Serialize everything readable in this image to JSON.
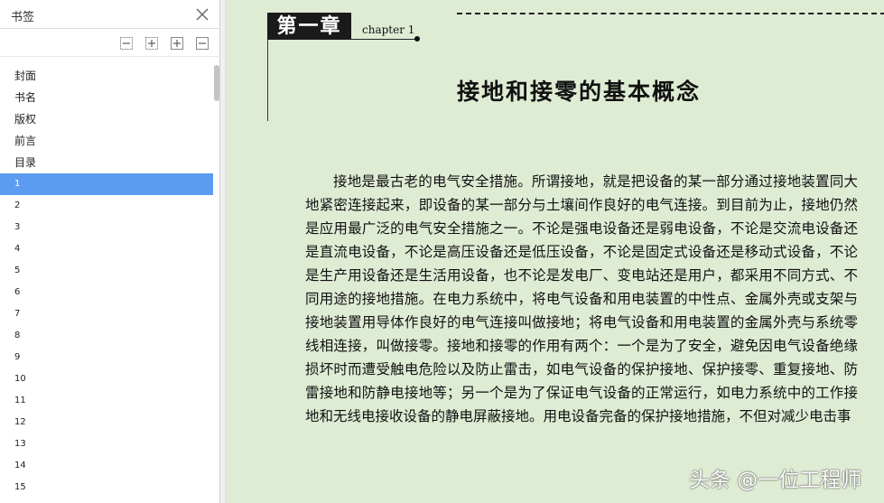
{
  "sidebar": {
    "title": "书签",
    "close_icon": "close-icon",
    "toolbar": [
      "collapse-all-icon",
      "expand-all-icon",
      "expand-current-icon",
      "collapse-current-icon"
    ],
    "items": [
      {
        "label": "封面"
      },
      {
        "label": "书名"
      },
      {
        "label": "版权"
      },
      {
        "label": "前言"
      },
      {
        "label": "目录"
      },
      {
        "label": "1",
        "selected": true
      },
      {
        "label": "2"
      },
      {
        "label": "3"
      },
      {
        "label": "4"
      },
      {
        "label": "5"
      },
      {
        "label": "6"
      },
      {
        "label": "7"
      },
      {
        "label": "8"
      },
      {
        "label": "9"
      },
      {
        "label": "10"
      },
      {
        "label": "11"
      },
      {
        "label": "12"
      },
      {
        "label": "13"
      },
      {
        "label": "14"
      },
      {
        "label": "15"
      }
    ]
  },
  "document": {
    "chapter_label": "第一章",
    "chapter_en": "chapter 1",
    "title": "接地和接零的基本概念",
    "body": "接地是最古老的电气安全措施。所谓接地，就是把设备的某一部分通过接地装置同大地紧密连接起来，即设备的某一部分与土壤间作良好的电气连接。到目前为止，接地仍然是应用最广泛的电气安全措施之一。不论是强电设备还是弱电设备，不论是交流电设备还是直流电设备，不论是高压设备还是低压设备，不论是固定式设备还是移动式设备，不论是生产用设备还是生活用设备，也不论是发电厂、变电站还是用户，都采用不同方式、不同用途的接地措施。在电力系统中，将电气设备和用电装置的中性点、金属外壳或支架与接地装置用导体作良好的电气连接叫做接地；将电气设备和用电装置的金属外壳与系统零线相连接，叫做接零。接地和接零的作用有两个：一个是为了安全，避免因电气设备绝缘损坏时而遭受触电危险以及防止雷击，如电气设备的保护接地、保护接零、重复接地、防雷接地和防静电接地等；另一个是为了保证电气设备的正常运行，如电力系统中的工作接地和无线电接收设备的静电屏蔽接地。用电设备完备的保护接地措施，不但对减少电击事",
    "watermark": "头条 @一位工程师"
  },
  "colors": {
    "selection": "#5b9bf0",
    "page_background": "#dfecd4"
  }
}
